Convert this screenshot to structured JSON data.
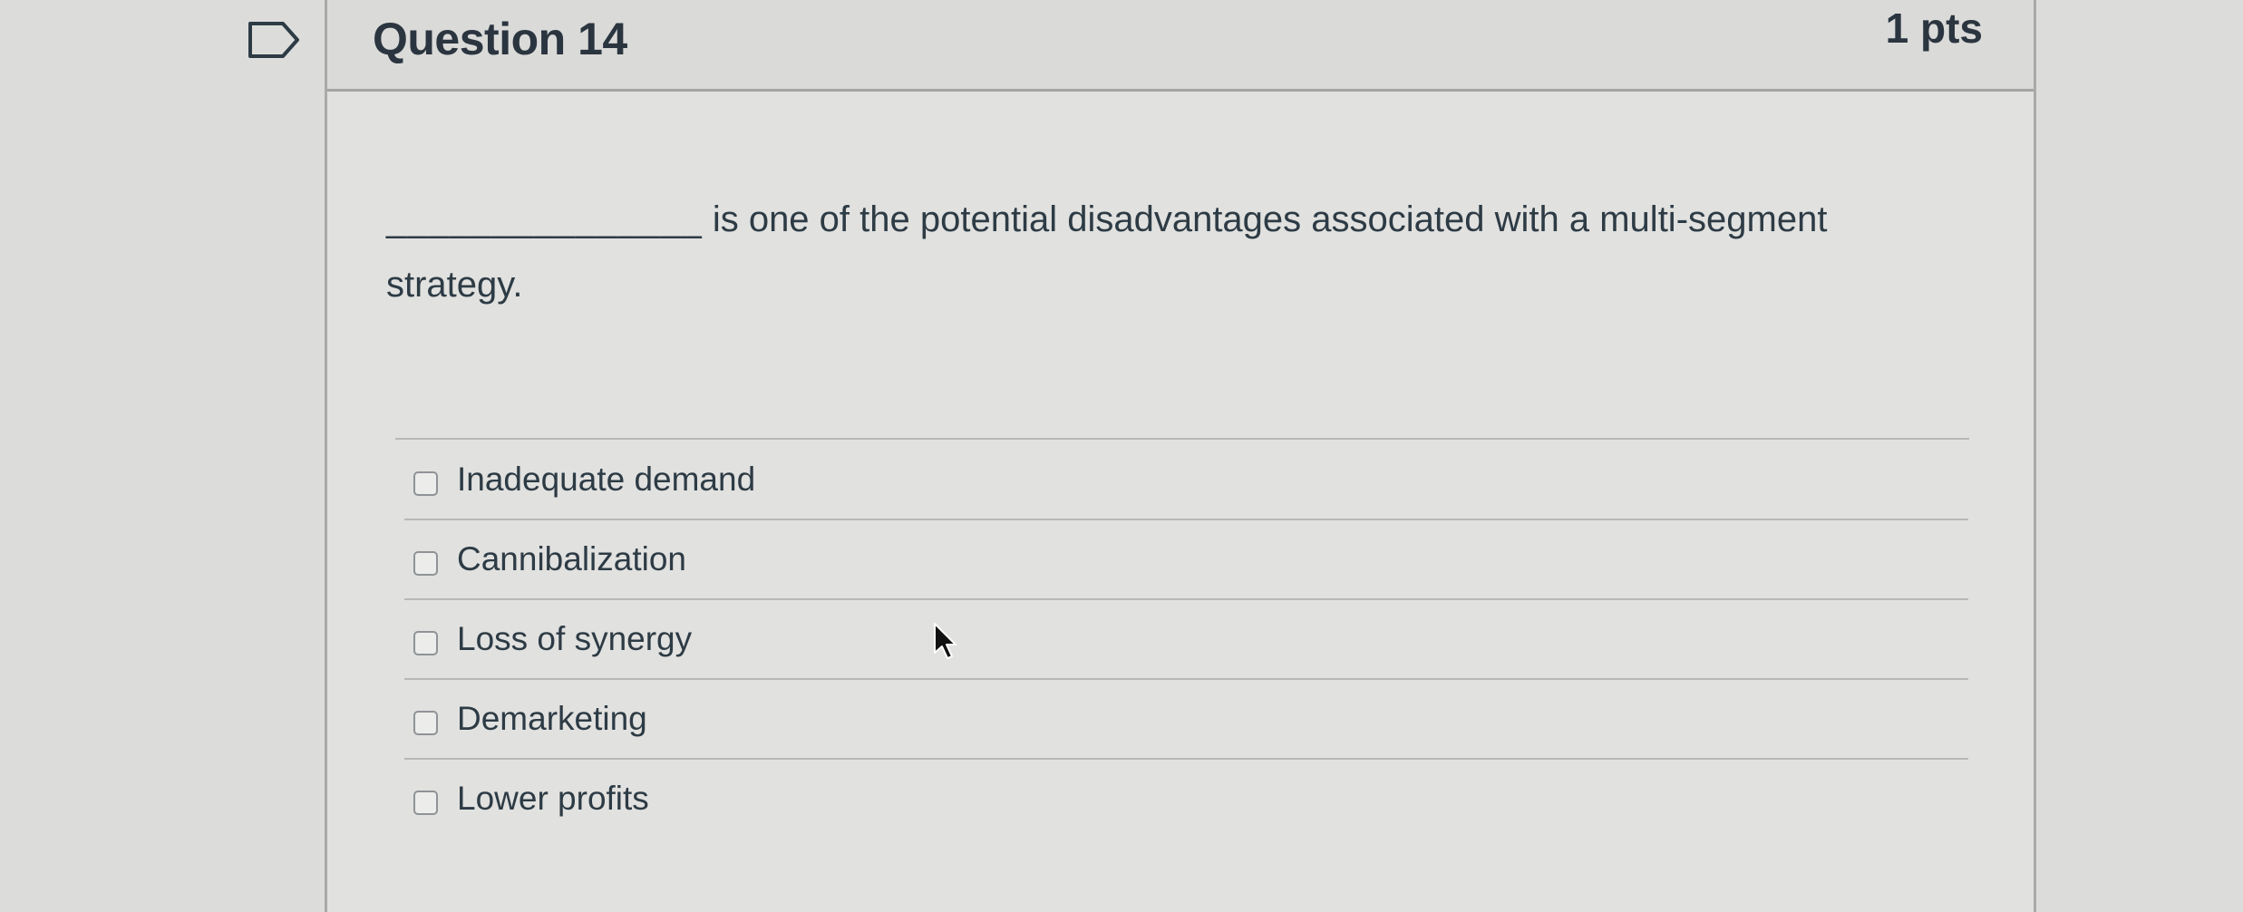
{
  "question": {
    "title": "Question 14",
    "points": "1 pts",
    "text_blank": "_______________",
    "text": " is one of the potential disadvantages associated with a multi-segment strategy."
  },
  "answers": [
    {
      "label": "Inadequate demand",
      "checked": false
    },
    {
      "label": "Cannibalization",
      "checked": false
    },
    {
      "label": "Loss of synergy",
      "checked": false
    },
    {
      "label": "Demarketing",
      "checked": false
    },
    {
      "label": "Lower profits",
      "checked": false
    }
  ],
  "icons": {
    "flag": "flag-question-icon",
    "cursor": "mouse-pointer-icon"
  },
  "colors": {
    "background": "#dcdcda",
    "card": "#e1e1df",
    "text": "#2d3b45"
  }
}
